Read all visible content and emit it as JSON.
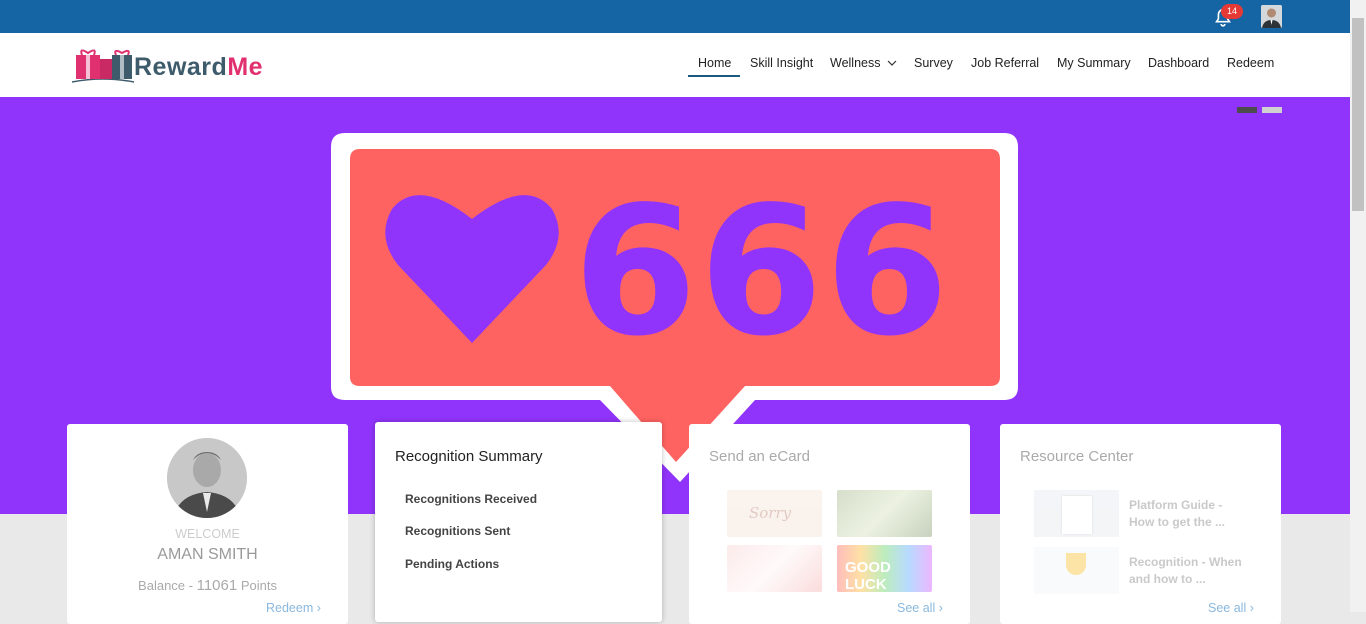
{
  "topbar": {
    "notification_count": "14",
    "bell_icon": "bell-icon",
    "avatar_icon": "user-avatar-icon"
  },
  "brand": {
    "name_part1": "Reward",
    "name_part2": "Me",
    "logo_icon": "gift-boxes-icon",
    "colors": {
      "dark": "#3d5b6b",
      "accent": "#e0306f"
    }
  },
  "nav": {
    "items": [
      "Home",
      "Skill Insight",
      "Wellness",
      "Survey",
      "Job Referral",
      "My Summary",
      "Dashboard",
      "Redeem"
    ],
    "active": "Home",
    "wellness_icon": "chevron-down-icon"
  },
  "banner": {
    "text": "666",
    "icon": "heart-icon",
    "bg_color": "#9134fb",
    "bubble_color": "#ff6060"
  },
  "profile": {
    "welcome": "WELCOME",
    "name": "AMAN SMITH",
    "balance_label": "Balance - ",
    "points": "11061",
    "points_label": " Points",
    "redeem": "Redeem ›"
  },
  "recognition": {
    "title": "Recognition Summary",
    "items": [
      "Recognitions Received",
      "Recognitions Sent",
      "Pending Actions"
    ]
  },
  "ecard": {
    "title": "Send an eCard",
    "cards": [
      "Sorry",
      "",
      "",
      "GOOD LUCK"
    ],
    "see_all": "See all ›"
  },
  "resources": {
    "title": "Resource Center",
    "items": [
      "Platform Guide - How to get the ...",
      "Recognition - When and how to ..."
    ],
    "see_all": "See all ›"
  }
}
